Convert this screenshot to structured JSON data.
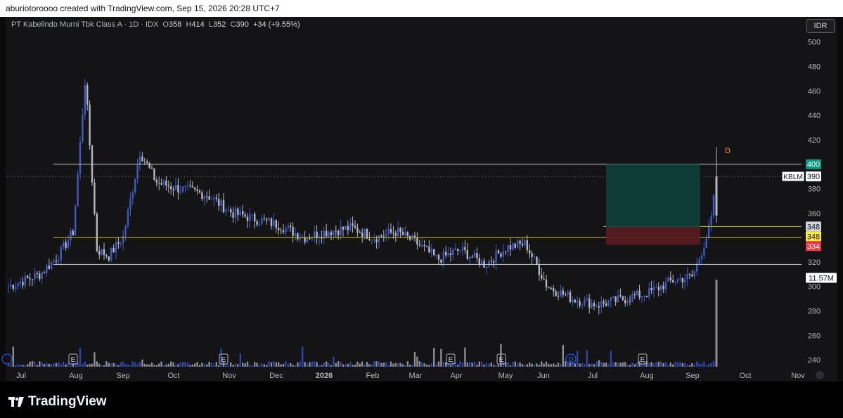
{
  "header": {
    "attribution": "aburiotoroooo created with TradingView.com, Sep 15, 2026 20:28 UTC+7"
  },
  "legend": {
    "symbol": "PT Kabelindo Murni Tbk Class A · 1D · IDX",
    "o_label": "O",
    "o_value": "358",
    "h_label": "H",
    "h_value": "414",
    "l_label": "L",
    "l_value": "352",
    "c_label": "C",
    "c_value": "390",
    "change": "+34 (+9.55%)"
  },
  "currency_button": "IDR",
  "footer": {
    "brand": "TradingView"
  },
  "colors": {
    "up": "#3f59c7",
    "down": "#b5b8c0",
    "volume_up": "#2e45a3",
    "volume_down": "#8a8d94",
    "profit_zone": "#0d4038",
    "loss_zone": "#5a1c20",
    "yellow_line": "#c8b347",
    "white_line": "#c9ccd3",
    "tp_label": "#089981",
    "sl_label": "#f23645",
    "entry_label": "#ffeb3b"
  },
  "chart_data": {
    "type": "candlestick",
    "symbol": "KBLM",
    "timeframe": "1D",
    "ylim": [
      232,
      505
    ],
    "y_ticks": [
      500,
      480,
      460,
      440,
      420,
      400,
      380,
      360,
      340,
      320,
      300,
      280,
      260,
      240
    ],
    "x_ticks": [
      "Jul",
      "Aug",
      "Sep",
      "Oct",
      "Nov",
      "Dec",
      "2026",
      "Feb",
      "Mar",
      "Apr",
      "May",
      "Jun",
      "Jul",
      "Aug",
      "Sep",
      "Oct",
      "Nov"
    ],
    "last": {
      "open": 358,
      "high": 414,
      "low": 352,
      "close": 390
    },
    "price_path": [
      [
        "Jul",
        300
      ],
      [
        "Jul",
        310
      ],
      [
        "Jul",
        325
      ],
      [
        "Aug",
        345
      ],
      [
        "Aug",
        470
      ],
      [
        "Aug",
        330
      ],
      [
        "Aug",
        325
      ],
      [
        "Sep",
        340
      ],
      [
        "Sep",
        410
      ],
      [
        "Sep",
        385
      ],
      [
        "Oct",
        380
      ],
      [
        "Oct",
        375
      ],
      [
        "Nov",
        360
      ],
      [
        "Nov",
        355
      ],
      [
        "Dec",
        350
      ],
      [
        "Dec",
        340
      ],
      [
        "2026",
        345
      ],
      [
        "2026",
        348
      ],
      [
        "Feb",
        340
      ],
      [
        "Feb",
        345
      ],
      [
        "Mar",
        335
      ],
      [
        "Mar",
        322
      ],
      [
        "Apr",
        330
      ],
      [
        "Apr",
        318
      ],
      [
        "May",
        332
      ],
      [
        "May",
        335
      ],
      [
        "Jun",
        300
      ],
      [
        "Jun",
        290
      ],
      [
        "Jul",
        285
      ],
      [
        "Jul",
        290
      ],
      [
        "Aug",
        295
      ],
      [
        "Aug",
        305
      ],
      [
        "Sep",
        308
      ],
      [
        "Sep",
        350
      ],
      [
        "Sep",
        390
      ]
    ],
    "horizontal_lines": [
      {
        "price": 400,
        "color": "white"
      },
      {
        "price": 340,
        "color": "yellow"
      },
      {
        "price": 318,
        "color": "white"
      },
      {
        "price": 349,
        "color": "yellow"
      }
    ],
    "position": {
      "target": 400,
      "entry": 348,
      "stop": 334
    },
    "price_labels": [
      {
        "text": "400",
        "price": 400,
        "kind": "target"
      },
      {
        "text": "390",
        "price": 390,
        "kind": "last",
        "tag": "KBLM"
      },
      {
        "text": "348",
        "price": 349,
        "kind": "gray"
      },
      {
        "text": "348",
        "price": 341,
        "kind": "entry"
      },
      {
        "text": "334",
        "price": 333,
        "kind": "stop"
      },
      {
        "text": "11.57M",
        "price": 307,
        "kind": "volume"
      }
    ],
    "event_markers": [
      {
        "label": "E",
        "x_tick": "Aug"
      },
      {
        "label": "E",
        "x_tick": "Nov"
      },
      {
        "label": "E",
        "x_tick": "Apr"
      },
      {
        "label": "E",
        "x_tick": "May"
      },
      {
        "label": "D",
        "x_tick": "Jul"
      },
      {
        "label": "E",
        "x_tick": "Aug"
      },
      {
        "label": "D",
        "x_tick": "Sep"
      }
    ],
    "volume_last": "11.57M"
  }
}
